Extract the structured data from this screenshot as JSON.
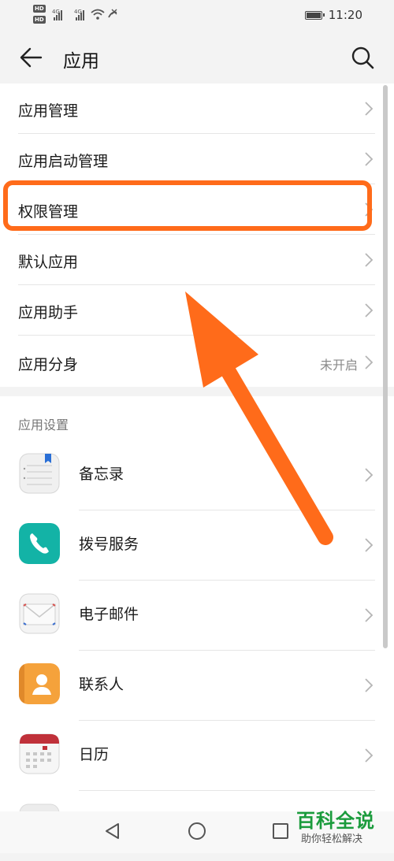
{
  "status_bar": {
    "time": "11:20",
    "hd1": "HD",
    "hd2": "HD",
    "net1": "4G",
    "net2": "4G"
  },
  "header": {
    "title": "应用"
  },
  "menu": [
    {
      "label": "应用管理",
      "value": ""
    },
    {
      "label": "应用启动管理",
      "value": ""
    },
    {
      "label": "权限管理",
      "value": ""
    },
    {
      "label": "默认应用",
      "value": ""
    },
    {
      "label": "应用助手",
      "value": ""
    },
    {
      "label": "应用分身",
      "value": "未开启"
    }
  ],
  "settings": {
    "title": "应用设置",
    "apps": [
      {
        "label": "备忘录",
        "icon": "memo-icon"
      },
      {
        "label": "拨号服务",
        "icon": "phone-icon"
      },
      {
        "label": "电子邮件",
        "icon": "mail-icon"
      },
      {
        "label": "联系人",
        "icon": "contacts-icon"
      },
      {
        "label": "日历",
        "icon": "calendar-icon"
      }
    ]
  },
  "watermark": {
    "title": "百科全说",
    "subtitle": "助你轻松解决"
  },
  "colors": {
    "highlight": "#ff6b1a",
    "watermark": "#1a9b3c"
  }
}
